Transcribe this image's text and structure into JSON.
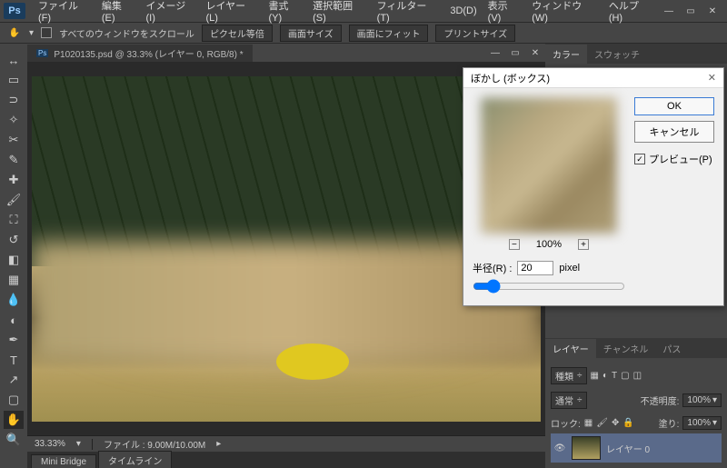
{
  "app": {
    "logo": "Ps"
  },
  "menu": [
    "ファイル(F)",
    "編集(E)",
    "イメージ(I)",
    "レイヤー(L)",
    "書式(Y)",
    "選択範囲(S)",
    "フィルター(T)",
    "3D(D)",
    "表示(V)",
    "ウィンドウ(W)",
    "ヘルプ(H)"
  ],
  "options": {
    "scroll_all": "すべてのウィンドウをスクロール",
    "btns": [
      "ピクセル等倍",
      "画面サイズ",
      "画面にフィット",
      "プリントサイズ"
    ]
  },
  "document": {
    "title": "P1020135.psd @ 33.3% (レイヤー 0, RGB/8) *",
    "zoom": "33.33%",
    "file_size": "ファイル : 9.00M/10.00M"
  },
  "bottom_tabs": [
    "Mini Bridge",
    "タイムライン"
  ],
  "right": {
    "color_tabs": [
      "カラー",
      "スウォッチ"
    ],
    "layer_tabs": [
      "レイヤー",
      "チャンネル",
      "パス"
    ],
    "layers": {
      "kind_label": "種類",
      "blend": "通常",
      "opacity_label": "不透明度:",
      "opacity": "100%",
      "lock_label": "ロック:",
      "fill_label": "塗り:",
      "fill": "100%",
      "layer0": "レイヤー 0"
    }
  },
  "dialog": {
    "title": "ぼかし (ボックス)",
    "ok": "OK",
    "cancel": "キャンセル",
    "preview": "プレビュー(P)",
    "zoom": "100%",
    "radius_label": "半径(R) :",
    "radius_value": "20",
    "radius_unit": "pixel"
  }
}
